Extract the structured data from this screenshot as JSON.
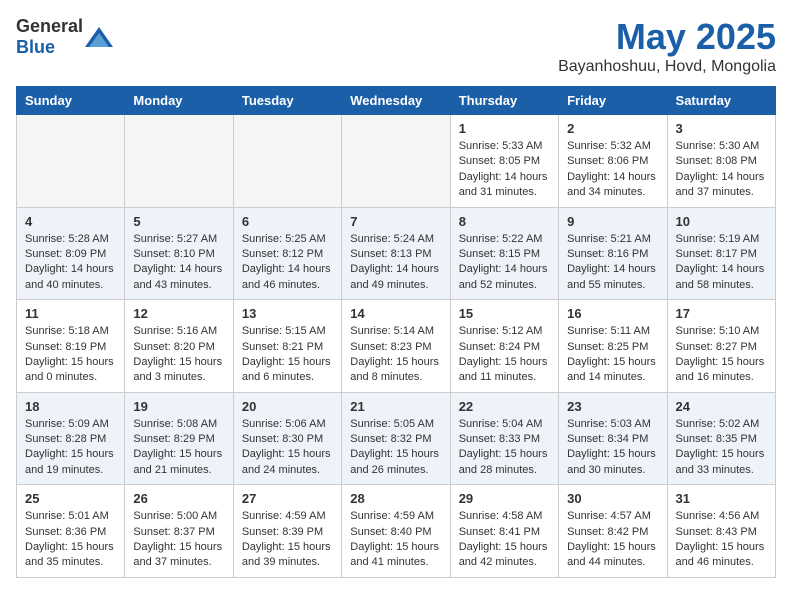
{
  "header": {
    "logo_general": "General",
    "logo_blue": "Blue",
    "month_title": "May 2025",
    "location": "Bayanhoshuu, Hovd, Mongolia"
  },
  "days_of_week": [
    "Sunday",
    "Monday",
    "Tuesday",
    "Wednesday",
    "Thursday",
    "Friday",
    "Saturday"
  ],
  "weeks": [
    [
      {
        "day": "",
        "empty": true
      },
      {
        "day": "",
        "empty": true
      },
      {
        "day": "",
        "empty": true
      },
      {
        "day": "",
        "empty": true
      },
      {
        "day": "1",
        "line1": "Sunrise: 5:33 AM",
        "line2": "Sunset: 8:05 PM",
        "line3": "Daylight: 14 hours",
        "line4": "and 31 minutes."
      },
      {
        "day": "2",
        "line1": "Sunrise: 5:32 AM",
        "line2": "Sunset: 8:06 PM",
        "line3": "Daylight: 14 hours",
        "line4": "and 34 minutes."
      },
      {
        "day": "3",
        "line1": "Sunrise: 5:30 AM",
        "line2": "Sunset: 8:08 PM",
        "line3": "Daylight: 14 hours",
        "line4": "and 37 minutes."
      }
    ],
    [
      {
        "day": "4",
        "line1": "Sunrise: 5:28 AM",
        "line2": "Sunset: 8:09 PM",
        "line3": "Daylight: 14 hours",
        "line4": "and 40 minutes."
      },
      {
        "day": "5",
        "line1": "Sunrise: 5:27 AM",
        "line2": "Sunset: 8:10 PM",
        "line3": "Daylight: 14 hours",
        "line4": "and 43 minutes."
      },
      {
        "day": "6",
        "line1": "Sunrise: 5:25 AM",
        "line2": "Sunset: 8:12 PM",
        "line3": "Daylight: 14 hours",
        "line4": "and 46 minutes."
      },
      {
        "day": "7",
        "line1": "Sunrise: 5:24 AM",
        "line2": "Sunset: 8:13 PM",
        "line3": "Daylight: 14 hours",
        "line4": "and 49 minutes."
      },
      {
        "day": "8",
        "line1": "Sunrise: 5:22 AM",
        "line2": "Sunset: 8:15 PM",
        "line3": "Daylight: 14 hours",
        "line4": "and 52 minutes."
      },
      {
        "day": "9",
        "line1": "Sunrise: 5:21 AM",
        "line2": "Sunset: 8:16 PM",
        "line3": "Daylight: 14 hours",
        "line4": "and 55 minutes."
      },
      {
        "day": "10",
        "line1": "Sunrise: 5:19 AM",
        "line2": "Sunset: 8:17 PM",
        "line3": "Daylight: 14 hours",
        "line4": "and 58 minutes."
      }
    ],
    [
      {
        "day": "11",
        "line1": "Sunrise: 5:18 AM",
        "line2": "Sunset: 8:19 PM",
        "line3": "Daylight: 15 hours",
        "line4": "and 0 minutes."
      },
      {
        "day": "12",
        "line1": "Sunrise: 5:16 AM",
        "line2": "Sunset: 8:20 PM",
        "line3": "Daylight: 15 hours",
        "line4": "and 3 minutes."
      },
      {
        "day": "13",
        "line1": "Sunrise: 5:15 AM",
        "line2": "Sunset: 8:21 PM",
        "line3": "Daylight: 15 hours",
        "line4": "and 6 minutes."
      },
      {
        "day": "14",
        "line1": "Sunrise: 5:14 AM",
        "line2": "Sunset: 8:23 PM",
        "line3": "Daylight: 15 hours",
        "line4": "and 8 minutes."
      },
      {
        "day": "15",
        "line1": "Sunrise: 5:12 AM",
        "line2": "Sunset: 8:24 PM",
        "line3": "Daylight: 15 hours",
        "line4": "and 11 minutes."
      },
      {
        "day": "16",
        "line1": "Sunrise: 5:11 AM",
        "line2": "Sunset: 8:25 PM",
        "line3": "Daylight: 15 hours",
        "line4": "and 14 minutes."
      },
      {
        "day": "17",
        "line1": "Sunrise: 5:10 AM",
        "line2": "Sunset: 8:27 PM",
        "line3": "Daylight: 15 hours",
        "line4": "and 16 minutes."
      }
    ],
    [
      {
        "day": "18",
        "line1": "Sunrise: 5:09 AM",
        "line2": "Sunset: 8:28 PM",
        "line3": "Daylight: 15 hours",
        "line4": "and 19 minutes."
      },
      {
        "day": "19",
        "line1": "Sunrise: 5:08 AM",
        "line2": "Sunset: 8:29 PM",
        "line3": "Daylight: 15 hours",
        "line4": "and 21 minutes."
      },
      {
        "day": "20",
        "line1": "Sunrise: 5:06 AM",
        "line2": "Sunset: 8:30 PM",
        "line3": "Daylight: 15 hours",
        "line4": "and 24 minutes."
      },
      {
        "day": "21",
        "line1": "Sunrise: 5:05 AM",
        "line2": "Sunset: 8:32 PM",
        "line3": "Daylight: 15 hours",
        "line4": "and 26 minutes."
      },
      {
        "day": "22",
        "line1": "Sunrise: 5:04 AM",
        "line2": "Sunset: 8:33 PM",
        "line3": "Daylight: 15 hours",
        "line4": "and 28 minutes."
      },
      {
        "day": "23",
        "line1": "Sunrise: 5:03 AM",
        "line2": "Sunset: 8:34 PM",
        "line3": "Daylight: 15 hours",
        "line4": "and 30 minutes."
      },
      {
        "day": "24",
        "line1": "Sunrise: 5:02 AM",
        "line2": "Sunset: 8:35 PM",
        "line3": "Daylight: 15 hours",
        "line4": "and 33 minutes."
      }
    ],
    [
      {
        "day": "25",
        "line1": "Sunrise: 5:01 AM",
        "line2": "Sunset: 8:36 PM",
        "line3": "Daylight: 15 hours",
        "line4": "and 35 minutes."
      },
      {
        "day": "26",
        "line1": "Sunrise: 5:00 AM",
        "line2": "Sunset: 8:37 PM",
        "line3": "Daylight: 15 hours",
        "line4": "and 37 minutes."
      },
      {
        "day": "27",
        "line1": "Sunrise: 4:59 AM",
        "line2": "Sunset: 8:39 PM",
        "line3": "Daylight: 15 hours",
        "line4": "and 39 minutes."
      },
      {
        "day": "28",
        "line1": "Sunrise: 4:59 AM",
        "line2": "Sunset: 8:40 PM",
        "line3": "Daylight: 15 hours",
        "line4": "and 41 minutes."
      },
      {
        "day": "29",
        "line1": "Sunrise: 4:58 AM",
        "line2": "Sunset: 8:41 PM",
        "line3": "Daylight: 15 hours",
        "line4": "and 42 minutes."
      },
      {
        "day": "30",
        "line1": "Sunrise: 4:57 AM",
        "line2": "Sunset: 8:42 PM",
        "line3": "Daylight: 15 hours",
        "line4": "and 44 minutes."
      },
      {
        "day": "31",
        "line1": "Sunrise: 4:56 AM",
        "line2": "Sunset: 8:43 PM",
        "line3": "Daylight: 15 hours",
        "line4": "and 46 minutes."
      }
    ]
  ]
}
